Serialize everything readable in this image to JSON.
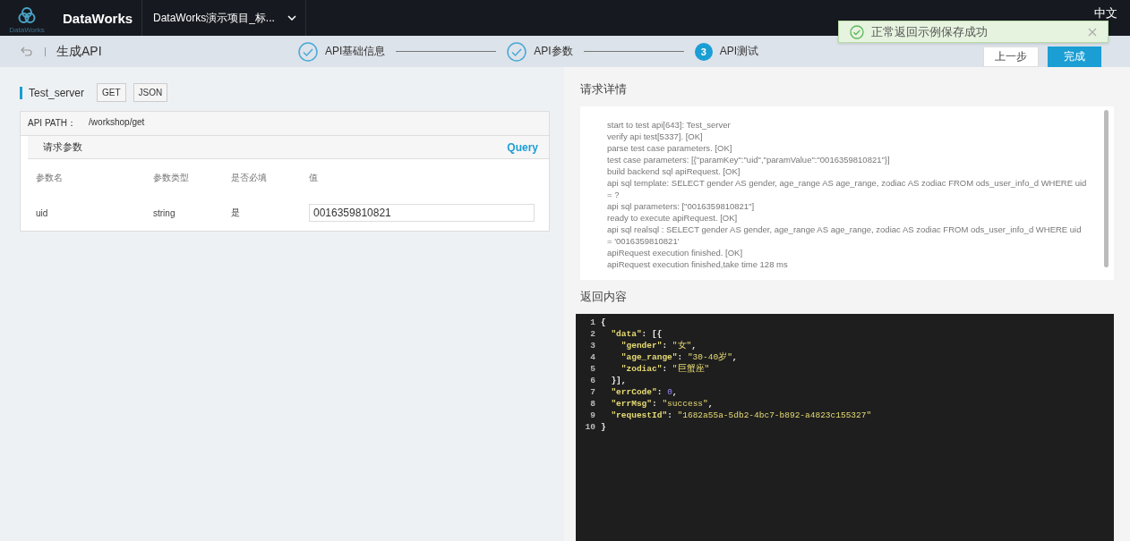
{
  "topbar": {
    "brand": "DataWorks",
    "logo_caption": "DataWorks",
    "project": "DataWorks演示项目_标...",
    "language": "中文"
  },
  "toast": {
    "message": "正常返回示例保存成功"
  },
  "subheader": {
    "title": "生成API",
    "steps": [
      {
        "label": "API基础信息",
        "done": true
      },
      {
        "label": "API参数",
        "done": true
      },
      {
        "label": "API测试",
        "done": false,
        "number": "3"
      }
    ],
    "buttons": [
      {
        "label": "上一步",
        "kind": "secondary"
      },
      {
        "label": "完成",
        "kind": "primary"
      }
    ]
  },
  "api": {
    "name": "Test_server",
    "tags": [
      "GET",
      "JSON"
    ],
    "path_label": "API PATH：",
    "path": "/workshop/get",
    "params_title": "请求参数",
    "params_mode": "Query",
    "columns": [
      "参数名",
      "参数类型",
      "是否必填",
      "值"
    ],
    "rows": [
      {
        "name": "uid",
        "type": "string",
        "required": "是",
        "value": "0016359810821"
      }
    ]
  },
  "request": {
    "title": "请求详情",
    "lines": [
      "start to test api[643]: Test_server",
      "verify api test[5337]. [OK]",
      "parse test case parameters. [OK]",
      "test case parameters: [{\"paramKey\":\"uid\",\"paramValue\":\"0016359810821\"}]",
      "build backend sql apiRequest. [OK]",
      "api sql template: SELECT gender AS gender, age_range AS age_range, zodiac AS zodiac FROM ods_user_info_d WHERE uid = ?",
      "api sql parameters: [\"0016359810821\"]",
      "ready to execute apiRequest. [OK]",
      "api sql realsql : SELECT gender AS gender, age_range AS age_range, zodiac AS zodiac FROM ods_user_info_d WHERE uid = '0016359810821'",
      "apiRequest execution finished. [OK]",
      "apiRequest execution finished,take time 128 ms"
    ]
  },
  "response": {
    "title": "返回内容",
    "lines": [
      {
        "number": "1",
        "tokens": [
          {
            "text": "{",
            "kind": "punct"
          }
        ]
      },
      {
        "number": "2",
        "tokens": [
          {
            "text": "  \"data\"",
            "kind": "key"
          },
          {
            "text": ": [{",
            "kind": "punct"
          }
        ]
      },
      {
        "number": "3",
        "tokens": [
          {
            "text": "    \"gender\"",
            "kind": "key"
          },
          {
            "text": ": ",
            "kind": "punct"
          },
          {
            "text": "\"女\"",
            "kind": "string"
          },
          {
            "text": ",",
            "kind": "punct"
          }
        ]
      },
      {
        "number": "4",
        "tokens": [
          {
            "text": "    \"age_range\"",
            "kind": "key"
          },
          {
            "text": ": ",
            "kind": "punct"
          },
          {
            "text": "\"30-40岁\"",
            "kind": "string"
          },
          {
            "text": ",",
            "kind": "punct"
          }
        ]
      },
      {
        "number": "5",
        "tokens": [
          {
            "text": "    \"zodiac\"",
            "kind": "key"
          },
          {
            "text": ": ",
            "kind": "punct"
          },
          {
            "text": "\"巨蟹座\"",
            "kind": "string"
          }
        ]
      },
      {
        "number": "6",
        "tokens": [
          {
            "text": "  }],",
            "kind": "punct"
          }
        ]
      },
      {
        "number": "7",
        "tokens": [
          {
            "text": "  \"errCode\"",
            "kind": "key"
          },
          {
            "text": ": ",
            "kind": "punct"
          },
          {
            "text": "0",
            "kind": "number"
          },
          {
            "text": ",",
            "kind": "punct"
          }
        ]
      },
      {
        "number": "8",
        "tokens": [
          {
            "text": "  \"errMsg\"",
            "kind": "key"
          },
          {
            "text": ": ",
            "kind": "punct"
          },
          {
            "text": "\"success\"",
            "kind": "string"
          },
          {
            "text": ",",
            "kind": "punct"
          }
        ]
      },
      {
        "number": "9",
        "tokens": [
          {
            "text": "  \"requestId\"",
            "kind": "key"
          },
          {
            "text": ": ",
            "kind": "punct"
          },
          {
            "text": "\"1682a55a-5db2-4bc7-b892-a4823c155327\"",
            "kind": "string"
          }
        ]
      },
      {
        "number": "10",
        "tokens": [
          {
            "text": "}",
            "kind": "punct"
          }
        ]
      }
    ]
  }
}
